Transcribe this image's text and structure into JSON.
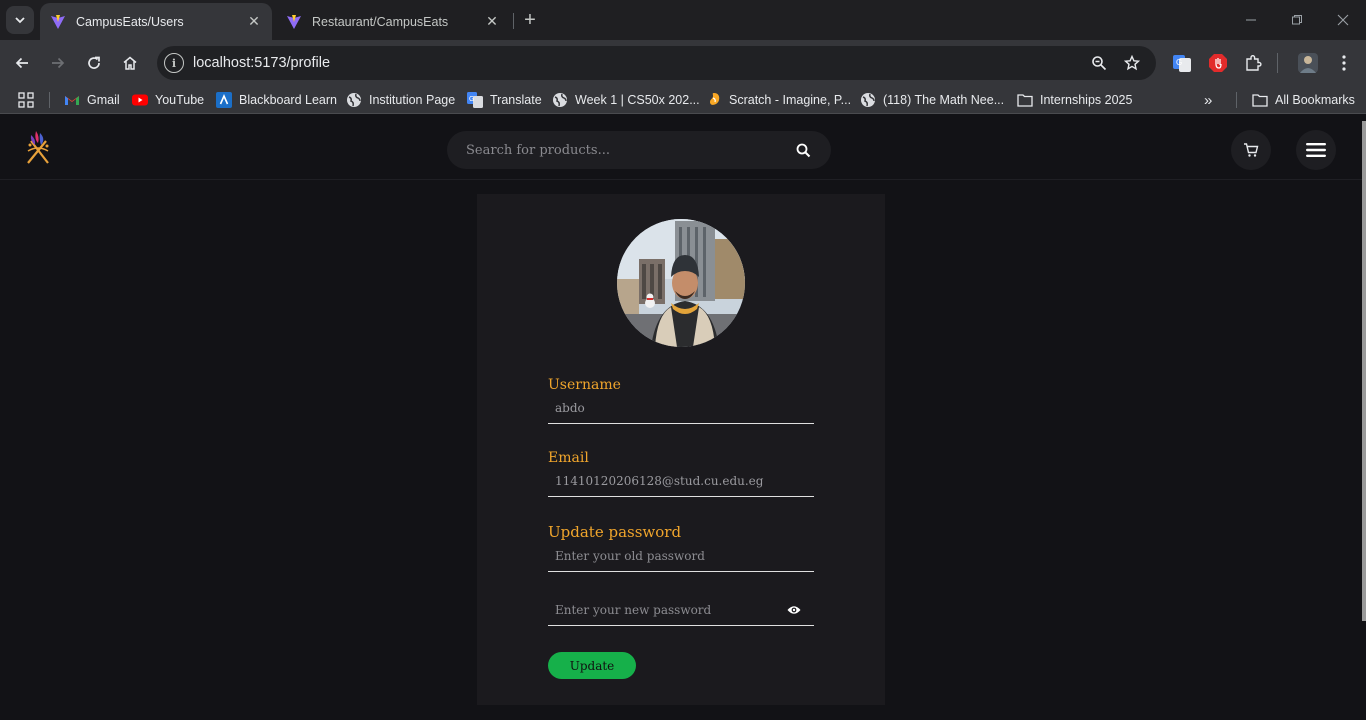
{
  "browser": {
    "tabs": [
      {
        "title": "CampusEats/Users",
        "active": true
      },
      {
        "title": "Restaurant/CampusEats",
        "active": false
      }
    ],
    "url": "localhost:5173/profile",
    "bookmarks": [
      {
        "label": "Gmail",
        "icon": "gmail-icon"
      },
      {
        "label": "YouTube",
        "icon": "youtube-icon"
      },
      {
        "label": "Blackboard Learn",
        "icon": "blackboard-icon"
      },
      {
        "label": "Institution Page",
        "icon": "globe-icon"
      },
      {
        "label": "Translate",
        "icon": "translate-icon"
      },
      {
        "label": "Week 1 | CS50x 202...",
        "icon": "globe-icon"
      },
      {
        "label": "Scratch - Imagine, P...",
        "icon": "scratch-icon"
      },
      {
        "label": "(118) The Math Nee...",
        "icon": "globe-icon"
      },
      {
        "label": "Internships 2025",
        "icon": "folder-icon"
      }
    ],
    "all_bookmarks_label": "All Bookmarks",
    "more_label": "»"
  },
  "header": {
    "search_placeholder": "Search for products..."
  },
  "profile": {
    "username_label": "Username",
    "username_value": "abdo",
    "email_label": "Email",
    "email_value": "11410120206128@stud.cu.edu.eg",
    "password_section_label": "Update password",
    "old_password_placeholder": "Enter your old password",
    "new_password_placeholder": "Enter your new password",
    "update_button_label": "Update"
  },
  "colors": {
    "accent_label": "#f0a52c",
    "update_button": "#16b04a",
    "page_background": "#121216",
    "card_background": "#1b1a1e"
  }
}
